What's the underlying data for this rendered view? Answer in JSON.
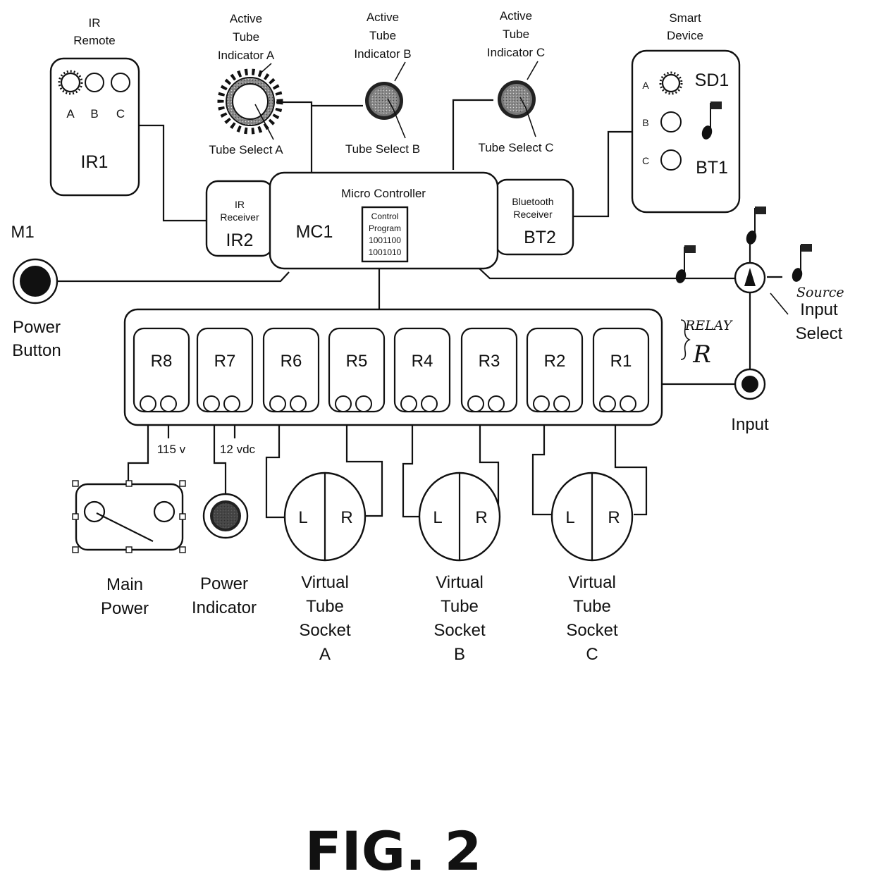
{
  "figure_label": "FIG. 2",
  "colors": {
    "ink": "#111111",
    "background": "#ffffff",
    "indicator_fill": "#7a7a7a"
  },
  "ir_remote": {
    "title": [
      "IR",
      "Remote"
    ],
    "id": "IR1",
    "buttons": [
      {
        "label": "A",
        "active": true
      },
      {
        "label": "B",
        "active": false
      },
      {
        "label": "C",
        "active": false
      }
    ]
  },
  "tube_indicators": [
    {
      "title": [
        "Active",
        "Tube",
        "Indicator A"
      ],
      "select_label": "Tube Select A",
      "active": true
    },
    {
      "title": [
        "Active",
        "Tube",
        "Indicator B"
      ],
      "select_label": "Tube Select B",
      "active": false
    },
    {
      "title": [
        "Active",
        "Tube",
        "Indicator C"
      ],
      "select_label": "Tube Select C",
      "active": false
    }
  ],
  "smart_device": {
    "title": [
      "Smart",
      "Device"
    ],
    "id_top": "SD1",
    "id_bottom": "BT1",
    "buttons": [
      {
        "label": "A",
        "active": true
      },
      {
        "label": "B",
        "active": false
      },
      {
        "label": "C",
        "active": false
      }
    ],
    "icon": "music-note-icon"
  },
  "ir_receiver": {
    "title": [
      "IR",
      "Receiver"
    ],
    "id": "IR2"
  },
  "micro_controller": {
    "title": "Micro Controller",
    "id": "MC1",
    "program": [
      "Control",
      "Program",
      "1001100",
      "1001010"
    ]
  },
  "bluetooth_receiver": {
    "title": [
      "Bluetooth",
      "Receiver"
    ],
    "id": "BT2"
  },
  "power_button": {
    "id": "M1",
    "label": [
      "Power",
      "Button"
    ]
  },
  "relay_bank": {
    "annotation": "RELAY",
    "annotation_id": "R",
    "relays": [
      "R8",
      "R7",
      "R6",
      "R5",
      "R4",
      "R3",
      "R2",
      "R1"
    ]
  },
  "source_input_select": {
    "label": [
      "Source",
      "Input",
      "Select"
    ],
    "input_label": "Input"
  },
  "voltages": {
    "main": "115 v",
    "indicator": "12 vdc"
  },
  "main_power": {
    "label": [
      "Main",
      "Power"
    ]
  },
  "power_indicator": {
    "label": [
      "Power",
      "Indicator"
    ]
  },
  "tube_sockets": [
    {
      "left": "L",
      "right": "R",
      "label": [
        "Virtual",
        "Tube",
        "Socket",
        "A"
      ]
    },
    {
      "left": "L",
      "right": "R",
      "label": [
        "Virtual",
        "Tube",
        "Socket",
        "B"
      ]
    },
    {
      "left": "L",
      "right": "R",
      "label": [
        "Virtual",
        "Tube",
        "Socket",
        "C"
      ]
    }
  ]
}
